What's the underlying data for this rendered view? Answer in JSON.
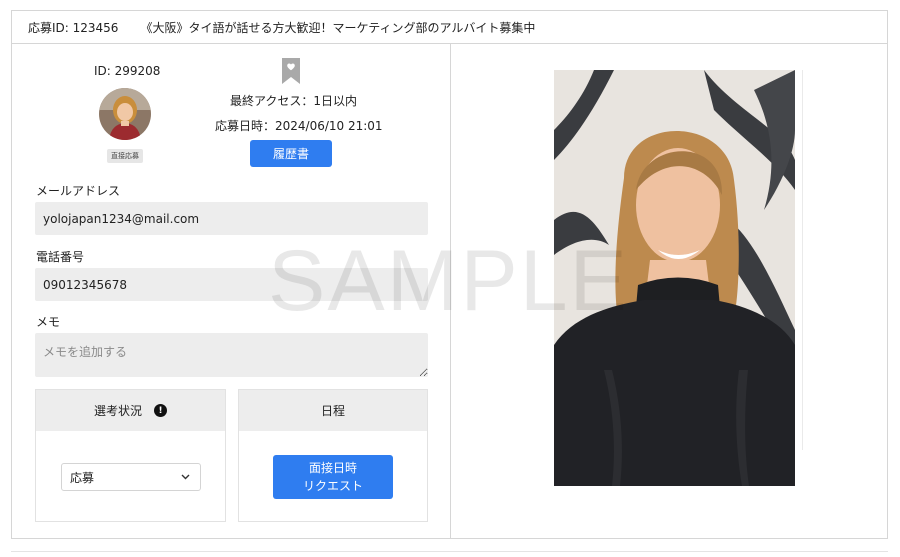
{
  "header": {
    "application_id": "応募ID: 123456",
    "job_title": "《大阪》タイ語が話せる方大歓迎！マーケティング部のアルバイト募集中"
  },
  "profile": {
    "user_id": "ID: 299208",
    "direct_badge": "直接応募",
    "last_access": "最終アクセス：1日以内",
    "applied_at": "応募日時：2024/06/10 21:01",
    "resume_button": "履歴書"
  },
  "contact": {
    "email_label": "メールアドレス",
    "email_value": "yolojapan1234@mail.com",
    "phone_label": "電話番号",
    "phone_value": "09012345678",
    "memo_label": "メモ",
    "memo_placeholder": "メモを追加する"
  },
  "status_card": {
    "title": "選考状況",
    "info_glyph": "!",
    "selected": "応募"
  },
  "schedule_card": {
    "title": "日程",
    "button_line1": "面接日時",
    "button_line2": "リクエスト"
  },
  "watermark": "SAMPLE",
  "icons": [
    "bookmark-icon",
    "info-icon",
    "chevron-down-icon"
  ],
  "colors": {
    "primary_button": "#2f7df0",
    "field_background": "#ededed",
    "border": "#d6d6d6",
    "card_header": "#ededed"
  }
}
